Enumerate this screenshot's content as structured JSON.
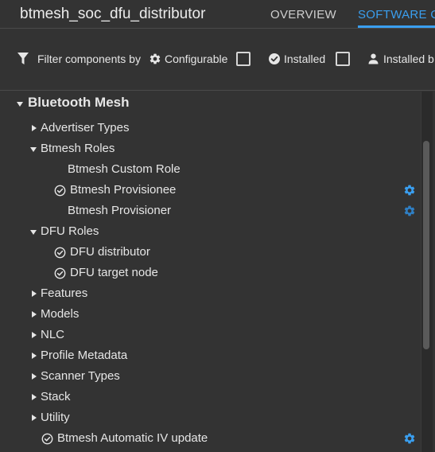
{
  "header": {
    "project_title": "btmesh_soc_dfu_distributor",
    "tabs": [
      {
        "label": "OVERVIEW"
      },
      {
        "label": "SOFTWARE C"
      }
    ]
  },
  "filter_bar": {
    "filter_label": "Filter components by",
    "configurable_label": "Configurable",
    "installed_label": "Installed",
    "installed_by_label": "Installed b"
  },
  "colors": {
    "accent": "#3a9ff0",
    "background": "#333333",
    "text": "#e6e6e6"
  },
  "tree": {
    "root_label": "Bluetooth Mesh",
    "advertiser_types": "Advertiser Types",
    "btmesh_roles": "Btmesh Roles",
    "btmesh_custom_role": "Btmesh Custom Role",
    "btmesh_provisionee": "Btmesh Provisionee",
    "btmesh_provisioner": "Btmesh Provisioner",
    "dfu_roles": "DFU Roles",
    "dfu_distributor": "DFU distributor",
    "dfu_target_node": "DFU target node",
    "features": "Features",
    "models": "Models",
    "nlc": "NLC",
    "profile_metadata": "Profile Metadata",
    "scanner_types": "Scanner Types",
    "stack": "Stack",
    "utility": "Utility",
    "btmesh_automatic_iv_update": "Btmesh Automatic IV update"
  }
}
